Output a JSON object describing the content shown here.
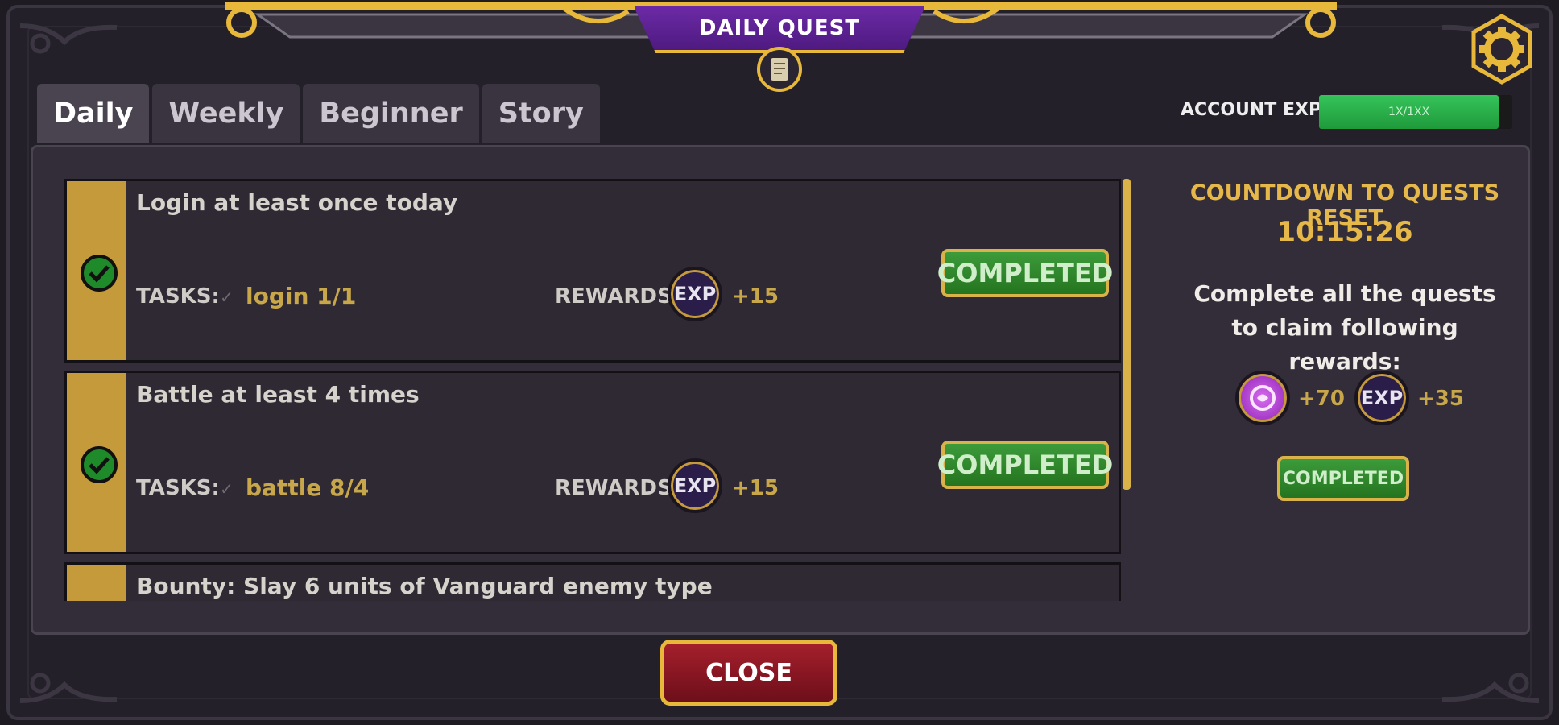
{
  "title": "DAILY QUEST",
  "tabs": [
    {
      "label": "Daily",
      "active": true
    },
    {
      "label": "Weekly",
      "active": false
    },
    {
      "label": "Beginner",
      "active": false
    },
    {
      "label": "Story",
      "active": false
    }
  ],
  "account": {
    "label": "ACCOUNT EXP:",
    "progress_text": "1X/1XX",
    "progress": 0.93
  },
  "quests": [
    {
      "title": "Login at least once today",
      "tasks_label": "TASKS:",
      "task": "login 1/1",
      "rewards_label": "REWARDS:",
      "reward_icon": "EXP",
      "reward_amount": "+15",
      "status": "COMPLETED"
    },
    {
      "title": "Battle at least 4 times",
      "tasks_label": "TASKS:",
      "task": "battle 8/4",
      "rewards_label": "REWARDS:",
      "reward_icon": "EXP",
      "reward_amount": "+15",
      "status": "COMPLETED"
    },
    {
      "title": "Bounty: Slay 6 units of Vanguard enemy type"
    }
  ],
  "reset": {
    "label": "COUNTDOWN TO QUESTS RESET",
    "time": "10:15:26",
    "claim_text": "Complete all the quests to claim following rewards:",
    "rewards": [
      {
        "icon": "gem-icon",
        "amount": "+70"
      },
      {
        "icon": "EXP",
        "amount": "+35"
      }
    ],
    "status": "COMPLETED"
  },
  "close_label": "CLOSE",
  "colors": {
    "accent_gold": "#e8b83a",
    "purple": "#6c2aa6",
    "green": "#3c9b3a",
    "red": "#a51f2c"
  }
}
